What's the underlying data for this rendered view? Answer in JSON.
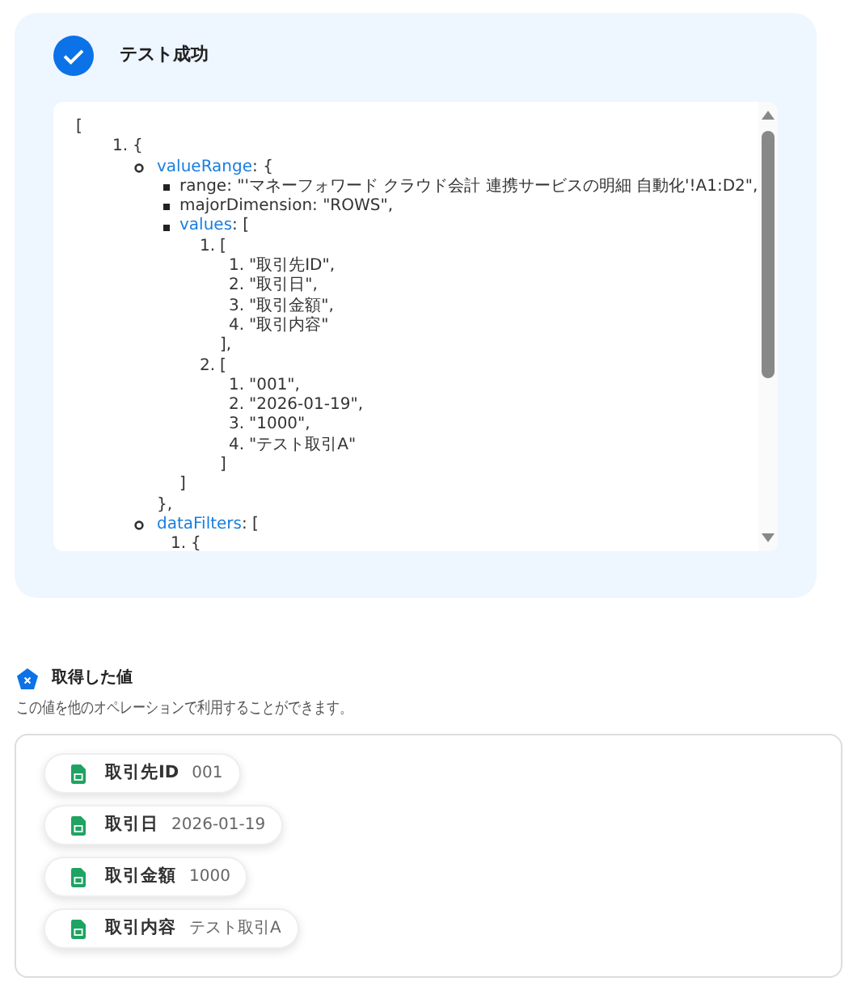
{
  "test_result": {
    "title": "テスト成功",
    "succeeded": true,
    "json_view": {
      "text": "[",
      "children": [
        {
          "kind": "numbered",
          "number": "1.",
          "text": "{",
          "children": [
            {
              "kind": "circle",
              "key": "valueRange",
              "text": ": {",
              "close": "},",
              "children": [
                {
                  "kind": "square",
                  "text": "range: \"'マネーフォワード クラウド会計 連携サービスの明細 自動化'!A1:D2\","
                },
                {
                  "kind": "square",
                  "text": "majorDimension: \"ROWS\","
                },
                {
                  "kind": "square",
                  "key": "values",
                  "text": ": [",
                  "close": "]",
                  "children": [
                    {
                      "kind": "numbered",
                      "number": "1.",
                      "text": "[",
                      "close": "],",
                      "children": [
                        {
                          "kind": "numbered",
                          "number": "1.",
                          "text": "\"取引先ID\","
                        },
                        {
                          "kind": "numbered",
                          "number": "2.",
                          "text": "\"取引日\","
                        },
                        {
                          "kind": "numbered",
                          "number": "3.",
                          "text": "\"取引金額\","
                        },
                        {
                          "kind": "numbered",
                          "number": "4.",
                          "text": "\"取引内容\""
                        }
                      ]
                    },
                    {
                      "kind": "numbered",
                      "number": "2.",
                      "text": "[",
                      "close": "]",
                      "children": [
                        {
                          "kind": "numbered",
                          "number": "1.",
                          "text": "\"001\","
                        },
                        {
                          "kind": "numbered",
                          "number": "2.",
                          "text": "\"2026-01-19\","
                        },
                        {
                          "kind": "numbered",
                          "number": "3.",
                          "text": "\"1000\","
                        },
                        {
                          "kind": "numbered",
                          "number": "4.",
                          "text": "\"テスト取引A\""
                        }
                      ]
                    }
                  ]
                }
              ]
            },
            {
              "kind": "circle",
              "key": "dataFilters",
              "text": ": [",
              "children": [
                {
                  "kind": "numbered",
                  "number": "1.",
                  "text": "{"
                }
              ]
            }
          ]
        }
      ]
    }
  },
  "retrieved_values": {
    "title": "取得した値",
    "description": "この値を他のオペレーションで利用することができます。",
    "items": [
      {
        "label": "取引先ID",
        "value": "001"
      },
      {
        "label": "取引日",
        "value": "2026-01-19"
      },
      {
        "label": "取引金額",
        "value": "1000"
      },
      {
        "label": "取引内容",
        "value": "テスト取引A"
      }
    ]
  }
}
